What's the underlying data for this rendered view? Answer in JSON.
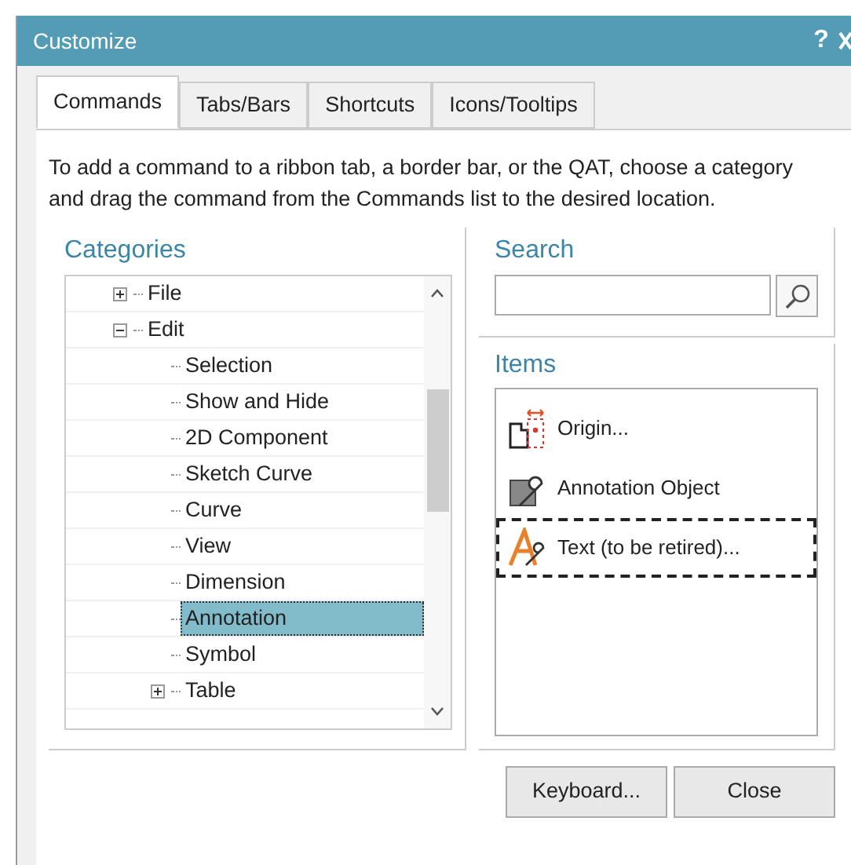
{
  "window": {
    "title": "Customize",
    "help": "?"
  },
  "tabs": [
    {
      "label": "Commands",
      "selected": true
    },
    {
      "label": "Tabs/Bars",
      "selected": false
    },
    {
      "label": "Shortcuts",
      "selected": false
    },
    {
      "label": "Icons/Tooltips",
      "selected": false
    }
  ],
  "description": "To add a command to a ribbon tab, a border bar, or the QAT, choose a category and drag the command from the Commands list to the desired location.",
  "categories": {
    "title": "Categories",
    "tree": [
      {
        "label": "File",
        "selected": false,
        "expanded": false
      },
      {
        "label": "Edit",
        "selected": false,
        "expanded": true,
        "children": [
          {
            "label": "Selection",
            "selected": false
          },
          {
            "label": "Show and Hide",
            "selected": false
          },
          {
            "label": "2D Component",
            "selected": false
          },
          {
            "label": "Sketch Curve",
            "selected": false
          },
          {
            "label": "Curve",
            "selected": false
          },
          {
            "label": "View",
            "selected": false
          },
          {
            "label": "Dimension",
            "selected": false
          },
          {
            "label": "Annotation",
            "selected": true
          },
          {
            "label": "Symbol",
            "selected": false
          },
          {
            "label": "Table",
            "selected": false,
            "expanded": false
          }
        ]
      }
    ]
  },
  "search": {
    "title": "Search"
  },
  "items": {
    "title": "Items",
    "list": [
      {
        "kind": "origin",
        "label": "Origin...",
        "selected": false
      },
      {
        "kind": "annotation",
        "label": "Annotation Object",
        "selected": false
      },
      {
        "kind": "text",
        "label": "Text (to be retired)...",
        "selected": true
      }
    ]
  },
  "buttons": [
    "Keyboard...",
    "Close"
  ]
}
